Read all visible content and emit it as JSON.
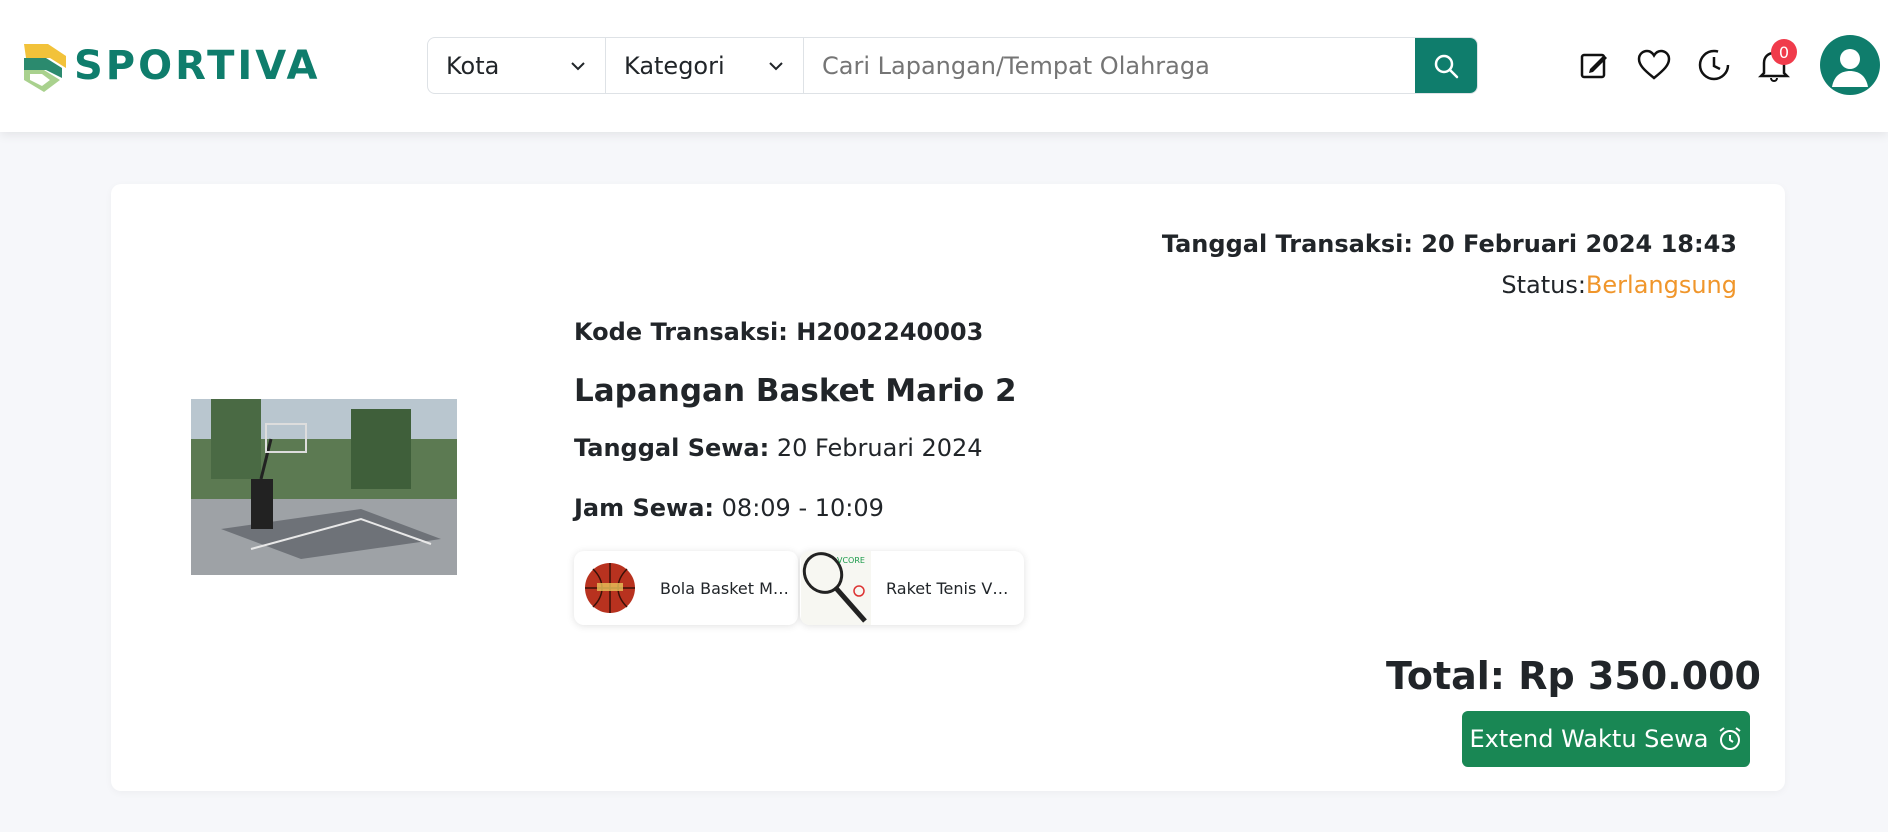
{
  "brand": {
    "name": "SPORTIVA",
    "accent": "#0f7d6c"
  },
  "search": {
    "city_label": "Kota",
    "category_label": "Kategori",
    "placeholder": "Cari Lapangan/Tempat Olahraga"
  },
  "header_icons": [
    "edit-icon",
    "heart-icon",
    "history-icon",
    "bell-icon",
    "user-icon"
  ],
  "notifications": {
    "count": "0"
  },
  "transaction": {
    "date_text": "Tanggal Transaksi: 20 Februari 2024 18:43",
    "status_label": "Status:",
    "status_value": "Berlangsung",
    "status_color": "#f0962b",
    "code_text": "Kode Transaksi: H2002240003",
    "venue_name": "Lapangan Basket Mario 2",
    "rent_date_label": "Tanggal Sewa:",
    "rent_date_value": "20 Februari 2024",
    "rent_time_label": "Jam Sewa:",
    "rent_time_value": "08:09 - 10:09",
    "items": [
      {
        "name": "Bola Basket Molten",
        "icon": "basketball-icon"
      },
      {
        "name": "Raket Tenis VCORE PRO",
        "icon": "tennis-racket-icon"
      }
    ],
    "total_text": "Total: Rp 350.000",
    "extend_label": "Extend Waktu Sewa"
  }
}
